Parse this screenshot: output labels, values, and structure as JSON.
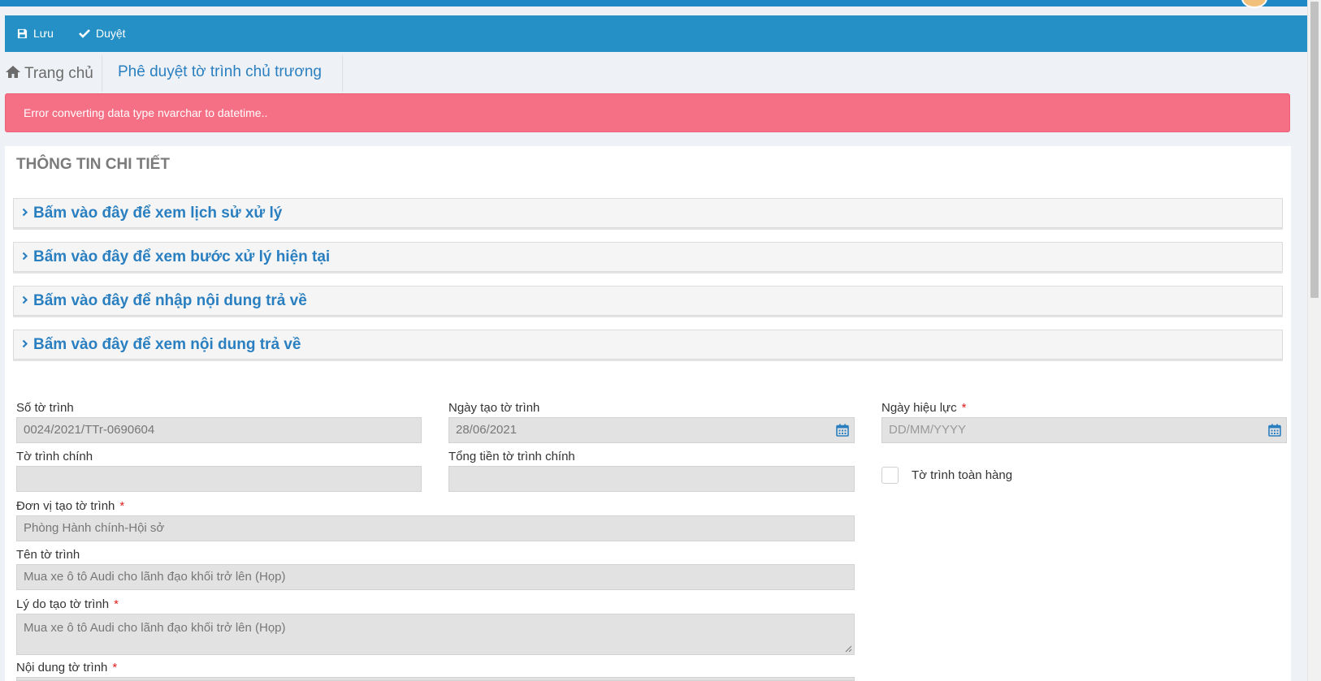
{
  "toolbar": {
    "save_label": "Lưu",
    "approve_label": "Duyệt"
  },
  "breadcrumb": {
    "home": "Trang chủ",
    "current": "Phê duyệt tờ trình chủ trương"
  },
  "alert": {
    "message": "Error converting data type nvarchar to datetime.."
  },
  "panel": {
    "title": "THÔNG TIN CHI TIẾT",
    "accordions": [
      {
        "label": "Bấm vào đây để xem lịch sử xử lý"
      },
      {
        "label": "Bấm vào đây để xem bước xử lý hiện tại"
      },
      {
        "label": "Bấm vào đây để nhập nội dung trả về"
      },
      {
        "label": "Bấm vào đây để xem nội dung trả về"
      }
    ]
  },
  "form": {
    "so_to_trinh": {
      "label": "Số tờ trình",
      "value": "0024/2021/TTr-0690604"
    },
    "ngay_tao": {
      "label": "Ngày tạo tờ trình",
      "value": "28/06/2021"
    },
    "ngay_hieu_luc": {
      "label": "Ngày hiệu lực",
      "required": "*",
      "placeholder": "DD/MM/YYYY"
    },
    "to_trinh_chinh": {
      "label": "Tờ trình chính",
      "value": ""
    },
    "tong_tien": {
      "label": "Tổng tiền tờ trình chính",
      "value": ""
    },
    "toan_hang": {
      "label": "Tờ trình toàn hàng",
      "checked": false
    },
    "don_vi": {
      "label": "Đơn vị tạo tờ trình",
      "required": "*",
      "value": "Phòng Hành chính-Hội sở"
    },
    "ten_to_trinh": {
      "label": "Tên tờ trình",
      "value": "Mua xe ô tô Audi cho lãnh đạo khối trở lên (Họp)"
    },
    "ly_do": {
      "label": "Lý do tạo tờ trình",
      "required": "*",
      "value": "Mua xe ô tô Audi cho lãnh đạo khối trở lên (Họp)"
    },
    "noi_dung": {
      "label": "Nội dung tờ trình",
      "required": "*"
    }
  }
}
